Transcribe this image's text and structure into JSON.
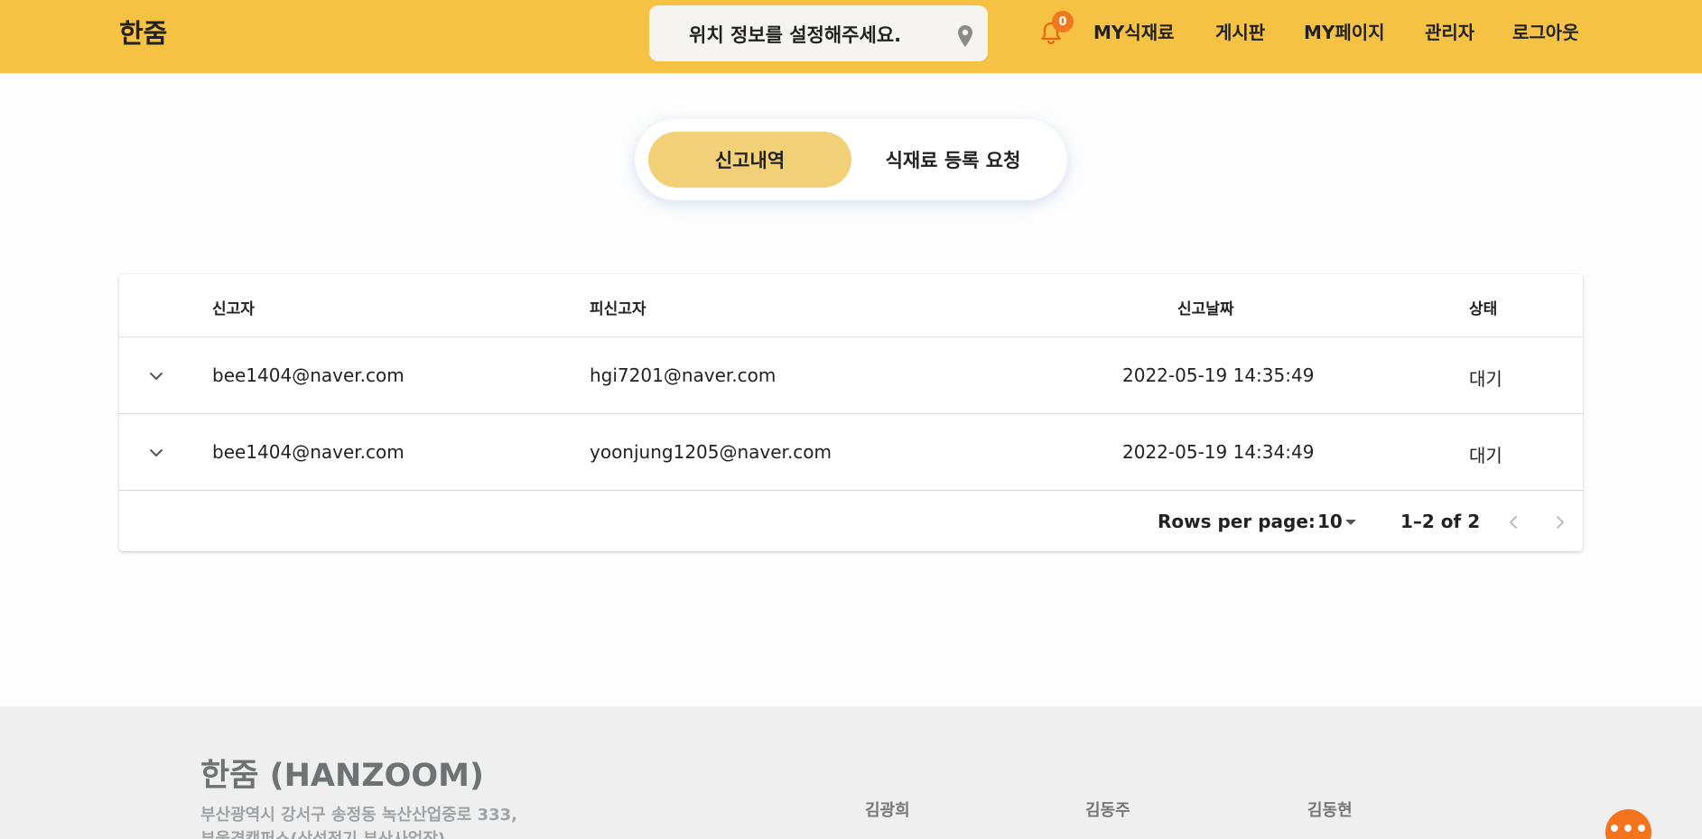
{
  "header": {
    "logo": "한줌",
    "location_text": "위치 정보를 설정해주세요.",
    "notification_count": "0",
    "nav": [
      "MY식재료",
      "게시판",
      "MY페이지",
      "관리자",
      "로그아웃"
    ]
  },
  "tabs": {
    "active": "신고내역",
    "inactive": "식재료 등록 요청"
  },
  "table": {
    "columns": [
      "신고자",
      "피신고자",
      "신고날짜",
      "상태"
    ],
    "rows": [
      {
        "reporter": "bee1404@naver.com",
        "reported": "hgi7201@naver.com",
        "date": "2022-05-19 14:35:49",
        "status": "대기"
      },
      {
        "reporter": "bee1404@naver.com",
        "reported": "yoonjung1205@naver.com",
        "date": "2022-05-19 14:34:49",
        "status": "대기"
      }
    ],
    "pagination": {
      "rows_per_page_label": "Rows per page:",
      "rows_per_page": "10",
      "range": "1–2 of 2"
    }
  },
  "footer": {
    "title": "한줌 (HANZOOM)",
    "address_line1": "부산광역시 강서구 송정동 녹산산업중로 333,",
    "address_line2": "부울경캠퍼스(삼성전기 부산사업장)",
    "members": [
      "김광희",
      "김동주",
      "김동현"
    ]
  },
  "colors": {
    "header_bg": "#f5c244",
    "active_tab": "#f2d077",
    "badge": "#f0781e",
    "fab": "#f4741e",
    "footer_bg": "#efefef"
  }
}
